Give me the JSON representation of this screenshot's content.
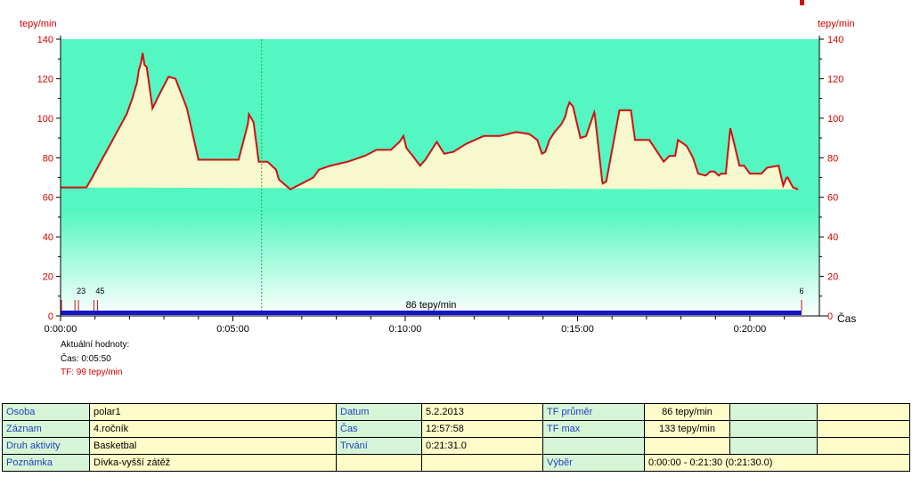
{
  "chart_data": {
    "type": "area",
    "ylabel_left": "tepy/min",
    "ylabel_right": "tepy/min",
    "xlabel": "Čas",
    "ylim": [
      0,
      140
    ],
    "xlim_seconds": [
      0,
      1290
    ],
    "y_ticks": [
      "0",
      "20",
      "40",
      "60",
      "80",
      "100",
      "120",
      "140"
    ],
    "x_ticks": [
      {
        "t": 0,
        "label": "0:00:00"
      },
      {
        "t": 300,
        "label": "0:05:00"
      },
      {
        "t": 600,
        "label": "0:10:00"
      },
      {
        "t": 900,
        "label": "0:15:00"
      },
      {
        "t": 1200,
        "label": "0:20:00"
      }
    ],
    "series": [
      {
        "name": "TF",
        "x_seconds": [
          0,
          45,
          55,
          70,
          85,
          100,
          115,
          125,
          130,
          133,
          136,
          140,
          143,
          146,
          150,
          160,
          172,
          188,
          200,
          220,
          240,
          250,
          262,
          280,
          310,
          326,
          328,
          336,
          345,
          360,
          375,
          380,
          400,
          420,
          440,
          450,
          470,
          500,
          530,
          550,
          561,
          565,
          575,
          590,
          597,
          602,
          610,
          613,
          618,
          626,
          635,
          655,
          668,
          684,
          706,
          737,
          765,
          793,
          816,
          830,
          838,
          844,
          851,
          860,
          872,
          879,
          882,
          886,
          892,
          905,
          915,
          929,
          930,
          943,
          944,
          950,
          973,
          990,
          993,
          1000,
          1003,
          1025,
          1050,
          1060,
          1070,
          1075,
          1090,
          1101,
          1110,
          1123,
          1131,
          1138,
          1146,
          1150,
          1158,
          1166,
          1172,
          1182,
          1190,
          1200,
          1215,
          1220,
          1230,
          1250,
          1258,
          1264,
          1266,
          1275,
          1284,
          1287,
          1290
        ],
        "values": [
          65,
          65,
          70,
          78,
          86,
          94,
          102,
          110,
          115,
          118,
          124,
          128,
          133,
          127,
          126,
          105,
          112,
          121,
          120,
          105,
          79,
          79,
          79,
          79,
          79,
          97,
          102,
          98,
          78,
          78,
          74,
          69,
          64,
          67,
          70,
          74,
          76,
          78,
          81,
          84,
          84,
          84,
          84,
          88,
          91,
          85,
          82,
          81,
          79,
          76,
          79,
          88,
          82,
          83,
          87,
          91,
          91,
          93,
          92,
          89,
          82,
          83,
          89,
          93,
          97,
          101,
          105,
          108,
          106,
          90,
          91,
          103,
          102,
          68,
          67,
          68,
          104,
          104,
          104,
          89,
          89,
          89,
          78,
          81,
          81,
          89,
          86,
          80,
          72,
          71,
          73,
          73,
          71,
          72,
          72,
          95,
          88,
          76,
          76,
          72,
          72,
          72,
          75,
          76,
          66,
          70,
          70,
          65,
          64
        ]
      }
    ],
    "legend": "none",
    "grid": "none",
    "marker_label": "86 tepy/min",
    "lap_marker_labels": [
      {
        "t": 25,
        "label": "23"
      },
      {
        "t": 58,
        "label": "45"
      },
      {
        "t": 1290,
        "label": "6"
      }
    ],
    "cursor_t": 350,
    "colors": {
      "line": "#d01010",
      "fill_below": "#f8f8cf",
      "bg_top": "#54f7c1",
      "bg_bottom": "#ffffff",
      "bar": "#1414c8",
      "axis_red": "#d60000"
    }
  },
  "info": {
    "title": "Aktuální hodnoty:",
    "time": "Čas: 0:05:50",
    "hr": "TF: 99 tepy/min"
  },
  "table": {
    "rows": [
      {
        "l1": "Osoba",
        "v1": "polar1",
        "l2": "Datum",
        "v2": "5.2.2013",
        "l3": "TF průměr",
        "v3": "86 tepy/min"
      },
      {
        "l1": "Záznam",
        "v1": "4.ročník",
        "l2": "Čas",
        "v2": "12:57:58",
        "l3": "TF max",
        "v3": "133 tepy/min"
      },
      {
        "l1": "Druh aktivity",
        "v1": "Basketbal",
        "l2": "Trvání",
        "v2": "0:21:31.0",
        "l3": "",
        "v3": ""
      },
      {
        "l1": "Poznámka",
        "v1": "Dívka-vyšší zátěž",
        "l2": "",
        "v2": "",
        "l3": "Výběr",
        "v3": "0:00:00 - 0:21:30 (0:21:30.0)"
      }
    ]
  }
}
